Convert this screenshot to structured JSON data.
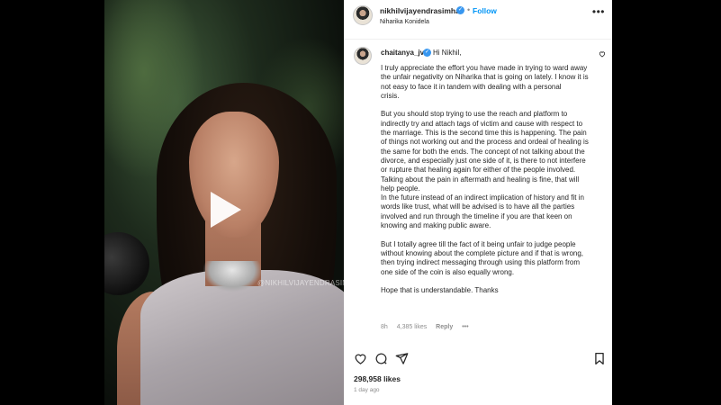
{
  "header": {
    "username": "nikhilvijayendrasimha",
    "subtitle": "Niharika Konidela",
    "follow_label": "Follow",
    "more_label": "•••",
    "dot": "•"
  },
  "media": {
    "watermark": "@NIKHILVIJAYENDRASIMHA",
    "play_icon": "play-icon"
  },
  "comment": {
    "username": "chaitanya_jv",
    "greeting": "Hi Nikhil,",
    "paragraphs": [
      "I truly appreciate the effort you have made in trying to ward away the unfair negativity on Niharika that is going on lately. I know it is not easy to face it in tandem with dealing with a personal\ncrisis.",
      "But you should stop trying to use the reach and platform to indirectly try and attach tags of victim and cause with respect to the marriage. This is the second time this is happening. The pain of things not working out and the process and ordeal of healing is the same for both the ends. The concept of not talking about the divorce, and especially just one side of it, is there to not interfere or rupture that healing again for either of the people involved. Talking about the pain in aftermath and healing is fine, that will help people.\nIn the future instead of an indirect implication of history and fit in words like trust, what will be advised is to have all the parties involved and run through the timeline if you are that keen on knowing and making public aware.",
      "But I totally agree till the fact of it being unfair to judge people without knowing about the complete picture and if that is wrong, then trying indirect messaging through using this platform from one side of the coin is also equally wrong.",
      "Hope that is understandable. Thanks"
    ],
    "time": "8h",
    "likes": "4,385 likes",
    "reply_label": "Reply",
    "more_label": "•••"
  },
  "footer": {
    "likes": "298,958 likes",
    "time_ago": "1 day ago"
  },
  "colors": {
    "link_blue": "#0095f6",
    "verified_blue": "#3897f0",
    "text": "#262626",
    "muted": "#8e8e8e"
  }
}
